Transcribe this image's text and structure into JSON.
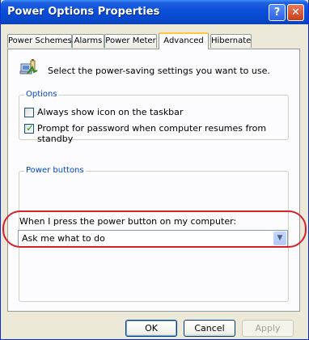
{
  "window": {
    "title": "Power Options Properties"
  },
  "titlebar": {
    "help_glyph": "?",
    "close_glyph": "✕"
  },
  "tabs": [
    {
      "label": "Power Schemes"
    },
    {
      "label": "Alarms"
    },
    {
      "label": "Power Meter"
    },
    {
      "label": "Advanced"
    },
    {
      "label": "Hibernate"
    }
  ],
  "advanced": {
    "description": "Select the power-saving settings you want to use.",
    "options": {
      "label": "Options",
      "always_show_icon": {
        "label": "Always show icon on the taskbar",
        "checked": false
      },
      "prompt_password": {
        "label": "Prompt for password when computer resumes from standby",
        "checked": true
      }
    },
    "power_buttons": {
      "label": "Power buttons",
      "prompt": "When I press the power button on my computer:",
      "selected": "Ask me what to do"
    }
  },
  "buttons": {
    "ok": "OK",
    "cancel": "Cancel",
    "apply": "Apply"
  },
  "colors": {
    "titlebar": "#0a4fd9",
    "group_label": "#0046d5",
    "annotation": "#d8202a"
  },
  "icons": {
    "power_settings": "computer-battery-icon",
    "check": "✓",
    "dropdown": "▼"
  }
}
